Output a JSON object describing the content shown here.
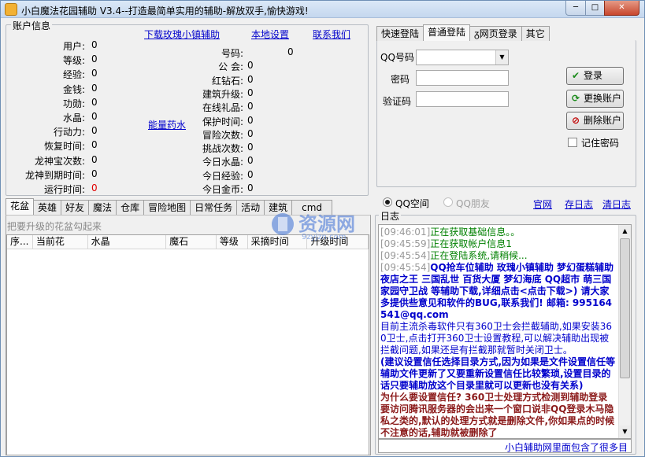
{
  "window": {
    "title": "小白魔法花园辅助 V3.4--打造最简单实用的辅助-解放双手,愉快游戏!",
    "min_glyph": "─",
    "max_glyph": "□",
    "close_glyph": "✕"
  },
  "account": {
    "group_title": "账户信息",
    "top_links": [
      "下载玫瑰小镇辅助",
      "本地设置",
      "联系我们"
    ],
    "energy_link": "能量药水",
    "left_fields": [
      {
        "label": "用户:",
        "value": "0"
      },
      {
        "label": "等级:",
        "value": "0"
      },
      {
        "label": "经验:",
        "value": "0"
      },
      {
        "label": "金钱:",
        "value": "0"
      },
      {
        "label": "功勋:",
        "value": "0"
      },
      {
        "label": "水晶:",
        "value": "0"
      },
      {
        "label": "行动力:",
        "value": "0"
      },
      {
        "label": "恢复时间:",
        "value": "0"
      },
      {
        "label": "龙神宝次数:",
        "value": "0"
      },
      {
        "label": "龙神到期时间:",
        "value": "0"
      },
      {
        "label": "运行时间:",
        "value": "0"
      }
    ],
    "mid_fields": [
      {
        "label": "号码:",
        "value": "0"
      },
      {
        "label": "公    会:",
        "value": "0"
      },
      {
        "label": "红钻石:",
        "value": "0"
      },
      {
        "label": "建筑升级:",
        "value": "0"
      },
      {
        "label": "在线礼品:",
        "value": "0"
      },
      {
        "label": "保护时间:",
        "value": "0"
      },
      {
        "label": "冒险次数:",
        "value": "0"
      },
      {
        "label": "挑战次数:",
        "value": "0"
      },
      {
        "label": "今日水晶:",
        "value": "0"
      },
      {
        "label": "今日经验:",
        "value": "0"
      },
      {
        "label": "今日金币:",
        "value": "0"
      }
    ]
  },
  "login": {
    "tabs": [
      "快速登陆",
      "普通登陆",
      "网页登录",
      "其它"
    ],
    "active_tab": 1,
    "qq_label": "QQ号码",
    "pwd_label": "密码",
    "code_label": "验证码",
    "login_btn": "登录",
    "switch_btn": "更换账户",
    "delete_btn": "删除账户",
    "remember_label": "记住密码"
  },
  "main_tabs": [
    "花盆",
    "英雄",
    "好友",
    "魔法",
    "仓库",
    "冒险地图",
    "日常任务",
    "活动",
    "建筑",
    "cmd"
  ],
  "pot": {
    "hint": "把要升级的花盆勾起来",
    "columns": [
      "序...",
      "当前花",
      "水晶",
      "魔石",
      "等级",
      "采摘时间",
      "升级时间"
    ]
  },
  "radio": {
    "qq_space": "QQ空间",
    "qq_friend": "QQ朋友"
  },
  "log_links": [
    "官网",
    "存日志",
    "清日志"
  ],
  "log_label": "日志",
  "log_lines": [
    {
      "time": "[09:46:01]",
      "text": "正在获取基础信息。。",
      "color": "#008000",
      "bold": false
    },
    {
      "time": "[09:45:59]",
      "text": "正在获取帐户信息1",
      "color": "#008000",
      "bold": false
    },
    {
      "time": "[09:45:54]",
      "text": "正在登陆系统,请稍候...",
      "color": "#008000",
      "bold": false
    },
    {
      "time": "[09:45:54]",
      "text": "QQ抢车位辅助  玫瑰小镇辅助  梦幻蛋糕辅助  夜店之王  三国乱世  百货大厦  梦幻海底  QQ超市  萌三国  家园守卫战  等辅助下载,详细点击<点击下载>) 请大家多提供些意见和软件的BUG,联系我们! 邮箱: 995164541@qq.com",
      "color": "#0000cc",
      "bold": true
    },
    {
      "time": "",
      "text": "目前主流杀毒软件只有360卫士会拦截辅助,如果安装360卫士,点击打开360卫士设置教程,可以解决辅助出现被拦截问题,如果还是有拦截那就暂时关闭卫士。",
      "color": "#0000cc",
      "bold": false
    },
    {
      "time": "",
      "text": "(建议设置信任选择目录方式,因为如果是文件设置信任等辅助文件更新了又要重新设置信任比较繁琐,设置目录的话只要辅助放这个目录里就可以更新也没有关系)",
      "color": "#0000cc",
      "bold": true
    },
    {
      "time": "",
      "text": "为什么要设置信任? 360卫士处理方式检测到辅助登录要访问腾讯服务器的会出来一个窗口说非QQ登录木马隐私之类的,默认的处理方式就是删除文件,你如果点的时候不注意的话,辅助就被删除了",
      "color": "#8b1a1a",
      "bold": true
    }
  ],
  "status_text": "小白辅助网里面包含了很多目",
  "watermark_text": "资源网",
  "watermark_url": "9zyjzn.com"
}
